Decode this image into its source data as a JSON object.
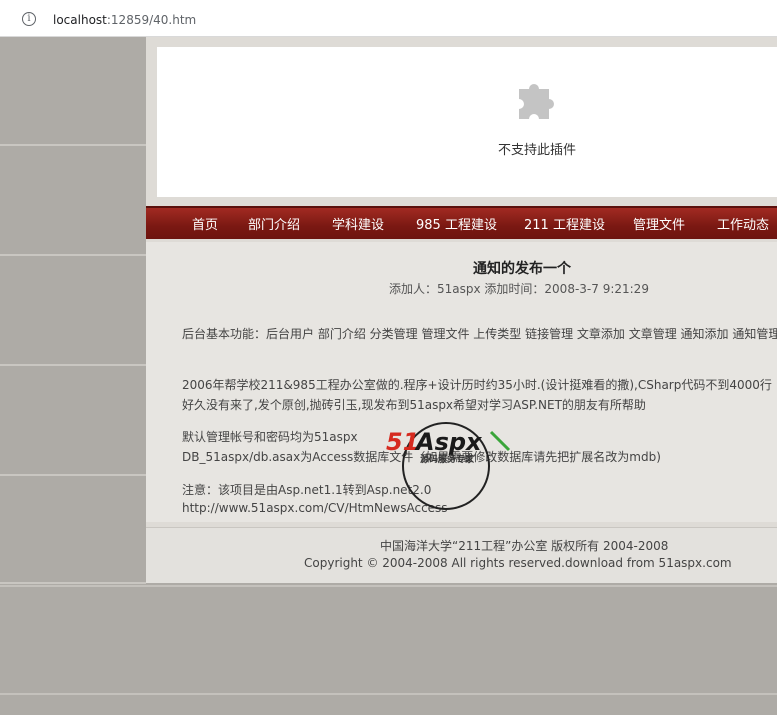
{
  "browser": {
    "url_host": "localhost",
    "url_rest": ":12859/40.htm"
  },
  "plugin": {
    "message": "不支持此插件"
  },
  "nav": {
    "items": [
      "首页",
      "部门介绍",
      "学科建设",
      "985 工程建设",
      "211 工程建设",
      "管理文件",
      "工作动态"
    ]
  },
  "article": {
    "title": "通知的发布一个",
    "meta": "添加人：51aspx  添加时间：2008-3-7 9:21:29",
    "p1": "后台基本功能：后台用户 部门介绍 分类管理 管理文件 上传类型 链接管理 文章添加 文章管理 通知添加 通知管理",
    "p2": "2006年帮学校211&985工程办公室做的.程序+设计历时约35小时.(设计挺难看的撒),CSharp代码不到4000行",
    "p3": "好久没有来了,发个原创,抛砖引玉,现发布到51aspx希望对学习ASP.NET的朋友有所帮助",
    "p4": "默认管理帐号和密码均为51aspx",
    "p5": "DB_51aspx/db.asax为Access数据库文件（如果需要修改数据库请先把扩展名改为mdb)",
    "p6": "注意：该项目是由Asp.net1.1转到Asp.net2.0",
    "p7": "http://www.51aspx.com/CV/HtmNewsAccess"
  },
  "watermark": {
    "logo_text": "51Aspx",
    "tagline": "源码服务专家"
  },
  "footer": {
    "line1": "中国海洋大学“211工程”办公室 版权所有 2004-2008",
    "line2": "Copyright © 2004-2008 All rights reserved.download from 51aspx.com"
  },
  "colors": {
    "nav_red": "#7a1812",
    "page_bg": "#aeaba6",
    "content_bg": "#e7e5e1",
    "watermark_red": "#d62a1f",
    "watermark_green": "#3aa53a"
  }
}
